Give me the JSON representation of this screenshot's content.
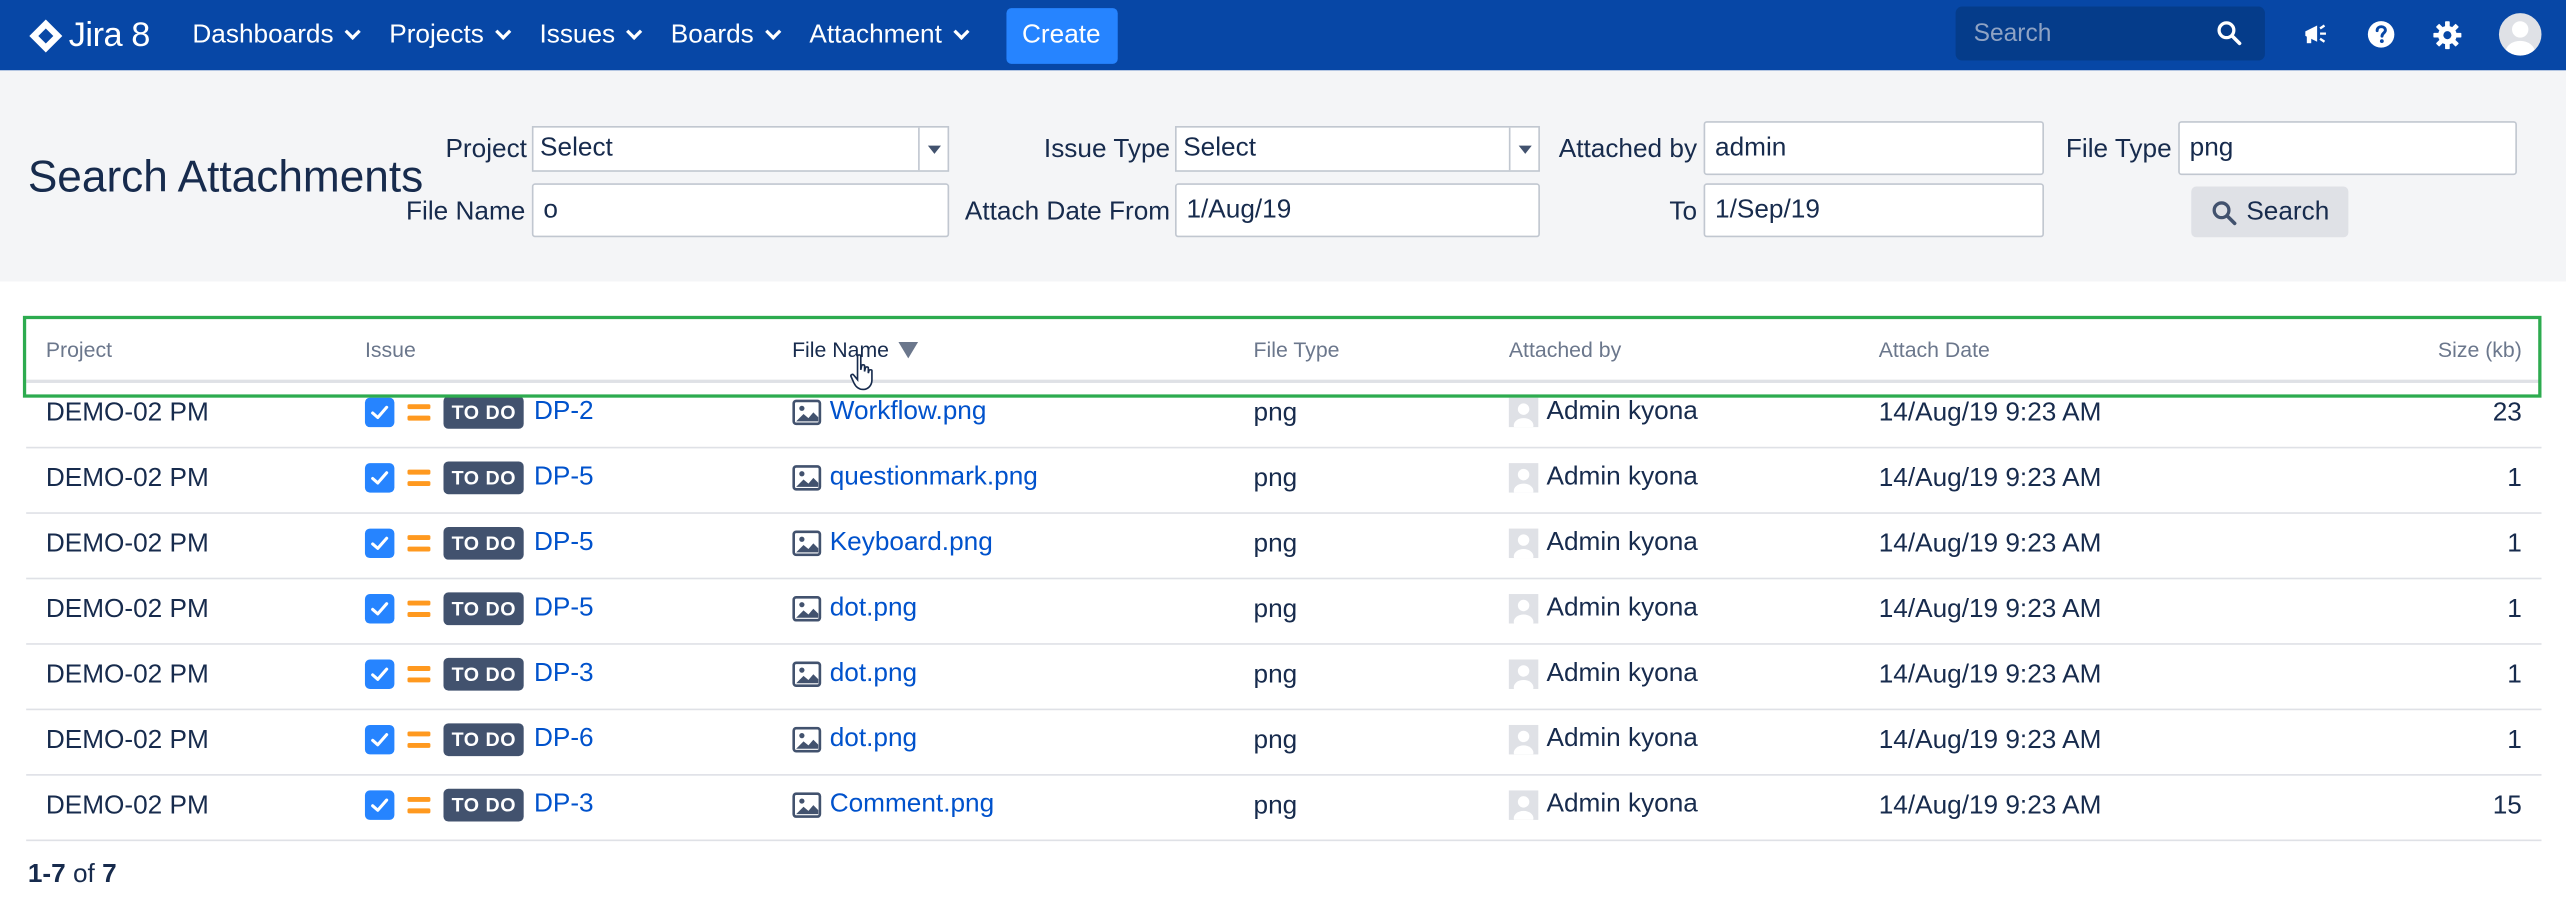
{
  "nav": {
    "logo_text": "Jira 8",
    "menu": [
      {
        "label": "Dashboards"
      },
      {
        "label": "Projects"
      },
      {
        "label": "Issues"
      },
      {
        "label": "Boards"
      },
      {
        "label": "Attachment"
      }
    ],
    "create_label": "Create",
    "search_placeholder": "Search",
    "icons": [
      "megaphone-icon",
      "help-icon",
      "gear-icon",
      "avatar"
    ]
  },
  "filters": {
    "title": "Search Attachments",
    "project_label": "Project",
    "project_value": "Select",
    "issue_type_label": "Issue Type",
    "issue_type_value": "Select",
    "attached_by_label": "Attached by",
    "attached_by_value": "admin",
    "file_type_label": "File Type",
    "file_type_value": "png",
    "file_name_label": "File Name",
    "file_name_value": "o",
    "date_from_label": "Attach Date From",
    "date_from_value": "1/Aug/19",
    "date_to_label": "To",
    "date_to_value": "1/Sep/19",
    "search_button": "Search"
  },
  "table": {
    "columns": {
      "project": "Project",
      "issue": "Issue",
      "file_name": "File Name",
      "file_type": "File Type",
      "attached_by": "Attached by",
      "attach_date": "Attach Date",
      "size": "Size (kb)"
    },
    "sorted_column": "File Name",
    "rows": [
      {
        "project": "DEMO-02 PM",
        "status": "TO DO",
        "key": "DP-2",
        "file": "Workflow.png",
        "type": "png",
        "user": "Admin kyona",
        "date": "14/Aug/19 9:23 AM",
        "size": "23"
      },
      {
        "project": "DEMO-02 PM",
        "status": "TO DO",
        "key": "DP-5",
        "file": "questionmark.png",
        "type": "png",
        "user": "Admin kyona",
        "date": "14/Aug/19 9:23 AM",
        "size": "1"
      },
      {
        "project": "DEMO-02 PM",
        "status": "TO DO",
        "key": "DP-5",
        "file": "Keyboard.png",
        "type": "png",
        "user": "Admin kyona",
        "date": "14/Aug/19 9:23 AM",
        "size": "1"
      },
      {
        "project": "DEMO-02 PM",
        "status": "TO DO",
        "key": "DP-5",
        "file": "dot.png",
        "type": "png",
        "user": "Admin kyona",
        "date": "14/Aug/19 9:23 AM",
        "size": "1"
      },
      {
        "project": "DEMO-02 PM",
        "status": "TO DO",
        "key": "DP-3",
        "file": "dot.png",
        "type": "png",
        "user": "Admin kyona",
        "date": "14/Aug/19 9:23 AM",
        "size": "1"
      },
      {
        "project": "DEMO-02 PM",
        "status": "TO DO",
        "key": "DP-6",
        "file": "dot.png",
        "type": "png",
        "user": "Admin kyona",
        "date": "14/Aug/19 9:23 AM",
        "size": "1"
      },
      {
        "project": "DEMO-02 PM",
        "status": "TO DO",
        "key": "DP-3",
        "file": "Comment.png",
        "type": "png",
        "user": "Admin kyona",
        "date": "14/Aug/19 9:23 AM",
        "size": "15"
      }
    ]
  },
  "pager": {
    "range": "1-7",
    "of": "of",
    "total": "7"
  },
  "colors": {
    "nav_bg": "#0747a6",
    "create_btn": "#2684ff",
    "link": "#0052cc",
    "highlight_box": "#2dab4f",
    "priority": "#ff991f",
    "status_bg": "#42526e"
  }
}
